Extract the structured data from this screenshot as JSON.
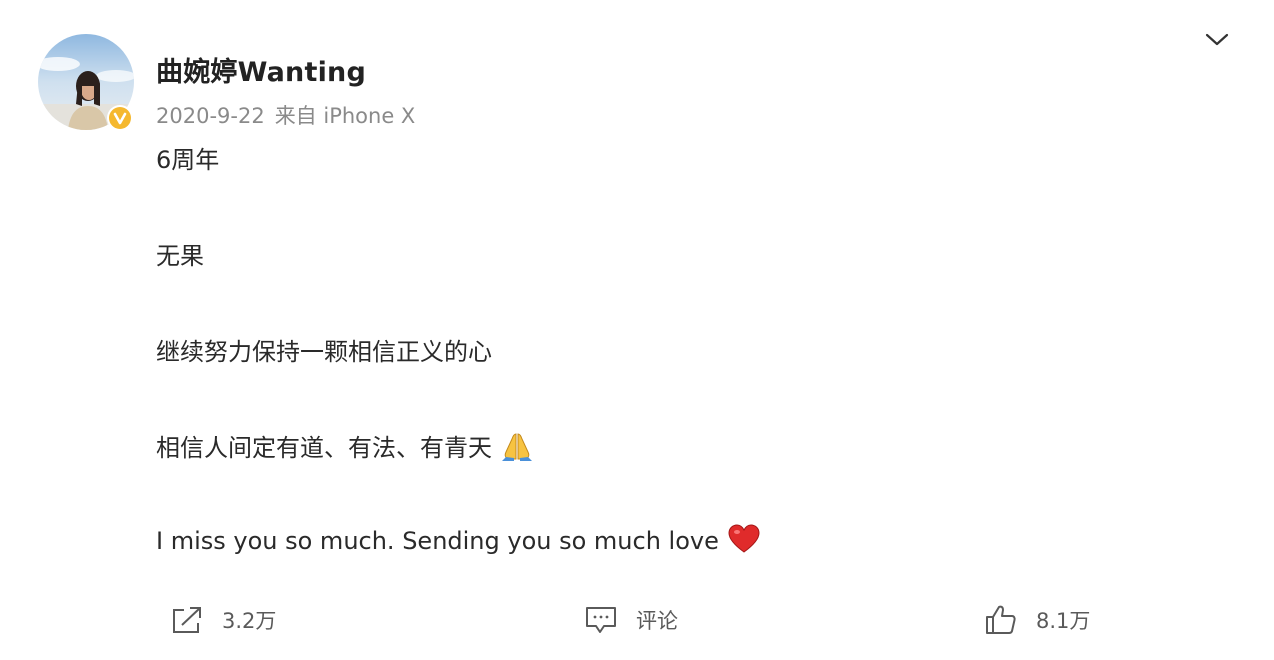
{
  "post": {
    "author": {
      "name": "曲婉婷Wanting",
      "verified": true,
      "verified_color": "#f5b82e"
    },
    "meta": {
      "date": "2020-9-22",
      "source": "来自 iPhone X"
    },
    "content": {
      "line1": "6周年",
      "line2": "无果",
      "line3": "继续努力保持一颗相信正义的心",
      "line4": "相信人间定有道、有法、有青天",
      "line4_emoji": "folded-hands",
      "line5": "I miss you so much. Sending you so much love",
      "line5_emoji": "red-heart"
    },
    "actions": {
      "repost": {
        "icon": "share-icon",
        "count": "3.2万"
      },
      "comment": {
        "icon": "comment-icon",
        "label": "评论"
      },
      "like": {
        "icon": "thumbs-up-icon",
        "count": "8.1万"
      }
    }
  }
}
